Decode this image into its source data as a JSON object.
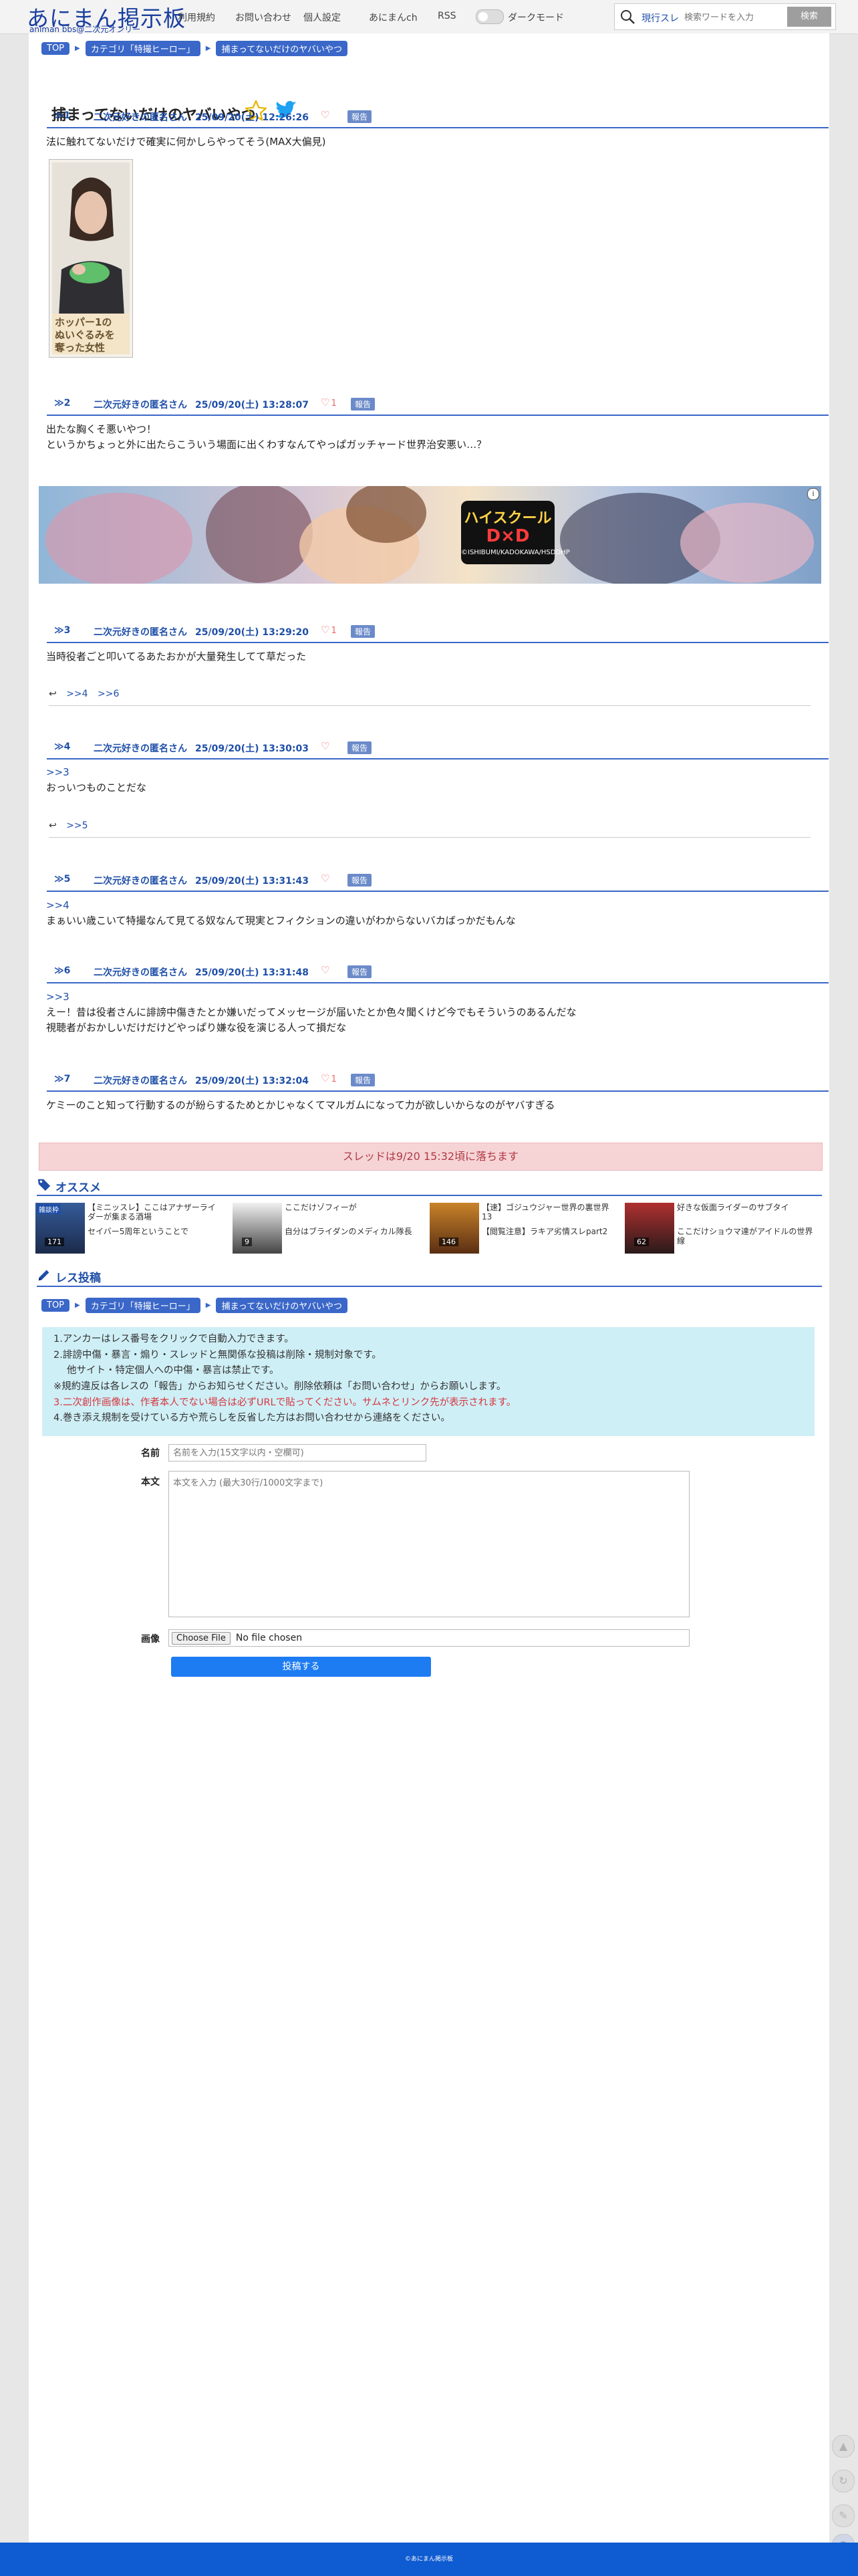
{
  "header": {
    "logo_title": "あにまん掲示板",
    "logo_sub": "animan bbs@二次元オンリー",
    "nav": [
      "利用規約",
      "お問い合わせ",
      "個人設定",
      "あにまんch",
      "RSS"
    ],
    "dark_mode_label": "ダークモード",
    "search_mode": "現行スレ",
    "search_placeholder": "検索ワードを入力",
    "search_button": "検索"
  },
  "breadcrumb": [
    "TOP",
    "カテゴリ「特撮ヒーロー」",
    "捕まってないだけのヤバいやつ"
  ],
  "thread": {
    "title": "捕まってないだけのヤバいやつ"
  },
  "report_label": "報告",
  "posts": [
    {
      "num": "1",
      "name": "二次元好きの匿名さん",
      "date": "25/09/20(土) 12:26:26",
      "likes": "",
      "anchor": "",
      "text": [
        "法に触れてないだけで確実に何かしらやってそう(MAX大偏見)"
      ],
      "image_caption": "ホッパー1の\nぬいぐるみを\n奪った女性",
      "replies": []
    },
    {
      "num": "2",
      "name": "二次元好きの匿名さん",
      "date": "25/09/20(土) 13:28:07",
      "likes": "1",
      "anchor": "",
      "text": [
        "出たな胸くそ悪いやつ！",
        "というかちょっと外に出たらこういう場面に出くわすなんてやっぱガッチャード世界治安悪い…？"
      ],
      "replies": []
    },
    {
      "num": "3",
      "name": "二次元好きの匿名さん",
      "date": "25/09/20(土) 13:29:20",
      "likes": "1",
      "anchor": "",
      "text": [
        "当時役者ごと叩いてるあたおかが大量発生してて草だった"
      ],
      "replies": [
        ">>4",
        ">>6"
      ]
    },
    {
      "num": "4",
      "name": "二次元好きの匿名さん",
      "date": "25/09/20(土) 13:30:03",
      "likes": "",
      "anchor": ">>3",
      "text": [
        "おっいつものことだな"
      ],
      "replies": [
        ">>5"
      ]
    },
    {
      "num": "5",
      "name": "二次元好きの匿名さん",
      "date": "25/09/20(土) 13:31:43",
      "likes": "",
      "anchor": ">>4",
      "text": [
        "まぁいい歳こいて特撮なんて見てる奴なんて現実とフィクションの違いがわからないバカばっかだもんな"
      ],
      "replies": []
    },
    {
      "num": "6",
      "name": "二次元好きの匿名さん",
      "date": "25/09/20(土) 13:31:48",
      "likes": "",
      "anchor": ">>3",
      "text": [
        "えー！昔は役者さんに誹謗中傷きたとか嫌いだってメッセージが届いたとか色々聞くけど今でもそういうのあるんだな",
        "視聴者がおかしいだけだけどやっぱり嫌な役を演じる人って損だな"
      ],
      "replies": []
    },
    {
      "num": "7",
      "name": "二次元好きの匿名さん",
      "date": "25/09/20(土) 13:32:04",
      "likes": "1",
      "anchor": "",
      "text": [
        "ケミーのこと知って行動するのが紛らするためとかじゃなくてマルガムになって力が欲しいからなのがヤバすぎる"
      ],
      "replies": []
    }
  ],
  "ad": {
    "logo_line1": "ハイスクール",
    "logo_line2": "D×D",
    "logo_line3": "©ISHIBUMI/KADOKAWA/HSDDHP",
    "info_icon": "i"
  },
  "notice": "スレッドは9/20 15:32頃に落ちます",
  "recommend": {
    "title": "オススメ",
    "items": [
      {
        "title": "【ミニッスレ】ここはアナザーライダーが集まる酒場",
        "subtitle": "セイバー5周年ということで",
        "badge": "雑談枠",
        "count": "171"
      },
      {
        "title": "ここだけゾフィーが",
        "subtitle": "自分はブライダンのメディカル隊長",
        "badge": "",
        "count": "9"
      },
      {
        "title": "【速】ゴジュウジャー世界の裏世界13",
        "subtitle": "【閲覧注意】ラキア劣情スレpart2",
        "badge": "",
        "count": "146"
      },
      {
        "title": "好きな仮面ライダーのサブタイ",
        "subtitle": "ここだけショウマ達がアイドルの世界線",
        "badge": "",
        "count": "62"
      }
    ]
  },
  "reply_form": {
    "title": "レス投稿",
    "rules": [
      "1.アンカーはレス番号をクリックで自動入力できます。",
      "2.誹謗中傷・暴言・煽り・スレッドと無関係な投稿は削除・規制対象です。",
      "他サイト・特定個人への中傷・暴言は禁止です。",
      "※規約違反は各レスの「報告」からお知らせください。削除依頼は「お問い合わせ」からお願いします。",
      "3.二次創作画像は、作者本人でない場合は必ずURLで貼ってください。サムネとリンク先が表示されます。",
      "4.巻き添え規制を受けている方や荒らしを反省した方はお問い合わせから連絡をください。"
    ],
    "name_label": "名前",
    "name_placeholder": "名前を入力(15文字以内・空欄可)",
    "body_label": "本文",
    "body_placeholder": "本文を入力 (最大30行/1000文字まで)",
    "image_label": "画像",
    "file_button": "Choose File",
    "file_text": "No file chosen",
    "submit": "投稿する"
  },
  "side_buttons": [
    "scroll-top-icon",
    "reload-icon",
    "pencil-icon",
    "gear-icon"
  ],
  "footer": "©あにまん掲示板",
  "colors": {
    "accent": "#3a67c8",
    "brand": "#1a3f9e",
    "footer": "#0f5bd1",
    "submit": "#1e7cf2",
    "notice_bg": "#f6d4d6",
    "rules_bg": "#cfeff6"
  }
}
